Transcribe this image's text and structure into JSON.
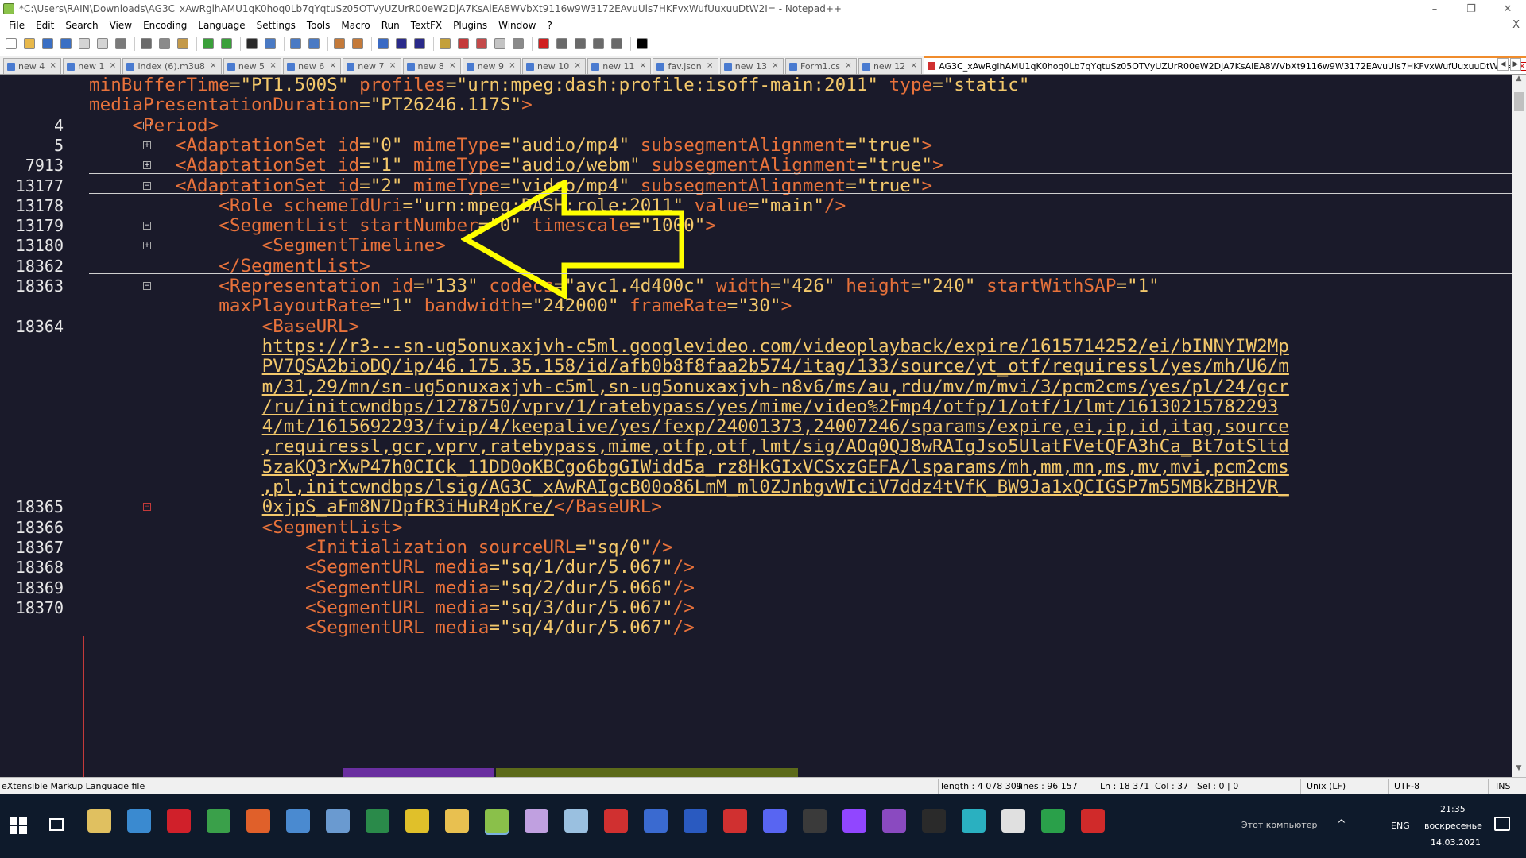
{
  "window": {
    "title": "*C:\\Users\\RAIN\\Downloads\\AG3C_xAwRglhAMU1qK0hoq0Lb7qYqtuSz05OTVyUZUrR00eW2DjA7KsAiEA8WVbXt9116w9W3172EAvuUls7HKFvxWufUuxuuDtW2I= - Notepad++",
    "controls": {
      "minimize": "–",
      "maximize": "❐",
      "close": "✕"
    }
  },
  "menu": [
    "File",
    "Edit",
    "Search",
    "View",
    "Encoding",
    "Language",
    "Settings",
    "Tools",
    "Macro",
    "Run",
    "TextFX",
    "Plugins",
    "Window",
    "?"
  ],
  "menu_close": "X",
  "toolbar_icons": [
    {
      "name": "new-file-icon",
      "color": "#ffffff"
    },
    {
      "name": "open-file-icon",
      "color": "#e8b84a"
    },
    {
      "name": "save-icon",
      "color": "#3a6fc4"
    },
    {
      "name": "save-all-icon",
      "color": "#3a6fc4"
    },
    {
      "name": "close-icon",
      "color": "#d4d4d4"
    },
    {
      "name": "close-all-icon",
      "color": "#d4d4d4"
    },
    {
      "name": "print-icon",
      "color": "#7a7a7a"
    },
    {
      "name": "cut-icon",
      "color": "#6a6a6a"
    },
    {
      "name": "copy-icon",
      "color": "#8a8a8a"
    },
    {
      "name": "paste-icon",
      "color": "#c49a4a"
    },
    {
      "name": "undo-icon",
      "color": "#3aa03a"
    },
    {
      "name": "redo-icon",
      "color": "#3aa03a"
    },
    {
      "name": "find-icon",
      "color": "#2a2a2a"
    },
    {
      "name": "replace-icon",
      "color": "#4a7ac4"
    },
    {
      "name": "zoom-in-icon",
      "color": "#4a7ac4"
    },
    {
      "name": "zoom-out-icon",
      "color": "#4a7ac4"
    },
    {
      "name": "sync-v-icon",
      "color": "#c47a3a"
    },
    {
      "name": "sync-h-icon",
      "color": "#c47a3a"
    },
    {
      "name": "word-wrap-icon",
      "color": "#3a6ac4"
    },
    {
      "name": "all-chars-icon",
      "color": "#2a2a8a"
    },
    {
      "name": "indent-guide-icon",
      "color": "#2a2a8a"
    },
    {
      "name": "udl-icon",
      "color": "#c4a03a"
    },
    {
      "name": "doc-map-icon",
      "color": "#c43a3a"
    },
    {
      "name": "func-list-icon",
      "color": "#c44a4a"
    },
    {
      "name": "folder-workspace-icon",
      "color": "#c4c4c4"
    },
    {
      "name": "monitor-icon",
      "color": "#8a8a8a"
    },
    {
      "name": "record-macro-icon",
      "color": "#d02020"
    },
    {
      "name": "stop-macro-icon",
      "color": "#6a6a6a"
    },
    {
      "name": "play-macro-icon",
      "color": "#6a6a6a"
    },
    {
      "name": "play-multi-icon",
      "color": "#6a6a6a"
    },
    {
      "name": "save-macro-icon",
      "color": "#6a6a6a"
    },
    {
      "name": "plugin-icon",
      "color": "#000000"
    }
  ],
  "tabs": [
    {
      "label": "new 4"
    },
    {
      "label": "new 1"
    },
    {
      "label": "index (6).m3u8"
    },
    {
      "label": "new 5"
    },
    {
      "label": "new 6"
    },
    {
      "label": "new 7"
    },
    {
      "label": "new 8"
    },
    {
      "label": "new 9"
    },
    {
      "label": "new 10"
    },
    {
      "label": "new 11"
    },
    {
      "label": "fav.json"
    },
    {
      "label": "new 13"
    },
    {
      "label": "Form1.cs"
    },
    {
      "label": "new 12"
    },
    {
      "label": "AG3C_xAwRglhAMU1qK0hoq0Lb7qYqtuSz05OTVyUZUrR00eW2DjA7KsAiEA8WVbXt9116w9W3172EAvuUls7HKFvxWufUuxuuDtW2I="
    }
  ],
  "tab_close": "×",
  "tab_scroll": {
    "left": "◀",
    "right": "▶"
  },
  "editor": {
    "line_numbers": [
      "",
      "",
      "4",
      "5",
      "7913",
      "13177",
      "13178",
      "13179",
      "13180",
      "18362",
      "18363",
      "",
      "18364",
      "",
      "",
      "",
      "",
      "",
      "",
      "",
      "",
      "18365",
      "18366",
      "18367",
      "18368",
      "18369",
      "18370"
    ],
    "fold_markers": [
      "",
      "",
      "−",
      "+",
      "+",
      "−",
      "",
      "−",
      "+",
      "",
      "−",
      "",
      "",
      "",
      "",
      "",
      "",
      "",
      "",
      "",
      "",
      "−",
      "",
      "",
      "",
      "",
      ""
    ],
    "lines": [
      {
        "indent": "",
        "parts": [
          {
            "c": "attr",
            "t": "minBufferTime"
          },
          {
            "c": "txt",
            "t": "="
          },
          {
            "c": "val",
            "t": "\"PT1.500S\""
          },
          {
            "c": "attr",
            "t": " profiles"
          },
          {
            "c": "txt",
            "t": "="
          },
          {
            "c": "val",
            "t": "\"urn:mpeg:dash:profile:isoff-main:2011\""
          },
          {
            "c": "attr",
            "t": " type"
          },
          {
            "c": "txt",
            "t": "="
          },
          {
            "c": "val",
            "t": "\"static\""
          }
        ]
      },
      {
        "indent": "",
        "parts": [
          {
            "c": "attr",
            "t": "mediaPresentationDuration"
          },
          {
            "c": "txt",
            "t": "="
          },
          {
            "c": "val",
            "t": "\"PT26246.117S\""
          },
          {
            "c": "tag",
            "t": ">"
          }
        ]
      },
      {
        "indent": "    ",
        "parts": [
          {
            "c": "tag",
            "t": "<Period>"
          }
        ]
      },
      {
        "indent": "        ",
        "parts": [
          {
            "c": "tag",
            "t": "<AdaptationSet"
          },
          {
            "c": "attr",
            "t": " id"
          },
          {
            "c": "txt",
            "t": "="
          },
          {
            "c": "val",
            "t": "\"0\""
          },
          {
            "c": "attr",
            "t": " mimeType"
          },
          {
            "c": "txt",
            "t": "="
          },
          {
            "c": "val",
            "t": "\"audio/mp4\""
          },
          {
            "c": "attr",
            "t": " subsegmentAlignment"
          },
          {
            "c": "txt",
            "t": "="
          },
          {
            "c": "val",
            "t": "\"true\""
          },
          {
            "c": "tag",
            "t": ">"
          }
        ]
      },
      {
        "indent": "        ",
        "parts": [
          {
            "c": "tag",
            "t": "<AdaptationSet"
          },
          {
            "c": "attr",
            "t": " id"
          },
          {
            "c": "txt",
            "t": "="
          },
          {
            "c": "val",
            "t": "\"1\""
          },
          {
            "c": "attr",
            "t": " mimeType"
          },
          {
            "c": "txt",
            "t": "="
          },
          {
            "c": "val",
            "t": "\"audio/webm\""
          },
          {
            "c": "attr",
            "t": " subsegmentAlignment"
          },
          {
            "c": "txt",
            "t": "="
          },
          {
            "c": "val",
            "t": "\"true\""
          },
          {
            "c": "tag",
            "t": ">"
          }
        ]
      },
      {
        "indent": "        ",
        "parts": [
          {
            "c": "tag",
            "t": "<AdaptationSet"
          },
          {
            "c": "attr",
            "t": " id"
          },
          {
            "c": "txt",
            "t": "="
          },
          {
            "c": "val",
            "t": "\"2\""
          },
          {
            "c": "attr",
            "t": " mimeType"
          },
          {
            "c": "txt",
            "t": "="
          },
          {
            "c": "val",
            "t": "\"video/mp4\""
          },
          {
            "c": "attr",
            "t": " subsegmentAlignment"
          },
          {
            "c": "txt",
            "t": "="
          },
          {
            "c": "val",
            "t": "\"true\""
          },
          {
            "c": "tag",
            "t": ">"
          }
        ]
      },
      {
        "indent": "            ",
        "parts": [
          {
            "c": "tag",
            "t": "<Role"
          },
          {
            "c": "attr",
            "t": " schemeIdUri"
          },
          {
            "c": "txt",
            "t": "="
          },
          {
            "c": "val",
            "t": "\"urn:mpeg:DASH:role:2011\""
          },
          {
            "c": "attr",
            "t": " value"
          },
          {
            "c": "txt",
            "t": "="
          },
          {
            "c": "val",
            "t": "\"main\""
          },
          {
            "c": "tag",
            "t": "/>"
          }
        ]
      },
      {
        "indent": "            ",
        "parts": [
          {
            "c": "tag",
            "t": "<SegmentList"
          },
          {
            "c": "attr",
            "t": " startNumber"
          },
          {
            "c": "txt",
            "t": "="
          },
          {
            "c": "val",
            "t": "\"0\""
          },
          {
            "c": "attr",
            "t": " timescale"
          },
          {
            "c": "txt",
            "t": "="
          },
          {
            "c": "val",
            "t": "\"1000\""
          },
          {
            "c": "tag",
            "t": ">"
          }
        ]
      },
      {
        "indent": "                ",
        "parts": [
          {
            "c": "tag",
            "t": "<SegmentTimeline>"
          }
        ]
      },
      {
        "indent": "            ",
        "parts": [
          {
            "c": "tag",
            "t": "</SegmentList>"
          }
        ]
      },
      {
        "indent": "            ",
        "parts": [
          {
            "c": "tag",
            "t": "<Representation"
          },
          {
            "c": "attr",
            "t": " id"
          },
          {
            "c": "txt",
            "t": "="
          },
          {
            "c": "val",
            "t": "\"133\""
          },
          {
            "c": "attr",
            "t": " codecs"
          },
          {
            "c": "txt",
            "t": "="
          },
          {
            "c": "val",
            "t": "\"avc1.4d400c\""
          },
          {
            "c": "attr",
            "t": " width"
          },
          {
            "c": "txt",
            "t": "="
          },
          {
            "c": "val",
            "t": "\"426\""
          },
          {
            "c": "attr",
            "t": " height"
          },
          {
            "c": "txt",
            "t": "="
          },
          {
            "c": "val",
            "t": "\"240\""
          },
          {
            "c": "attr",
            "t": " startWithSAP"
          },
          {
            "c": "txt",
            "t": "="
          },
          {
            "c": "val",
            "t": "\"1\""
          }
        ]
      },
      {
        "indent": "            ",
        "parts": [
          {
            "c": "attr",
            "t": "maxPlayoutRate"
          },
          {
            "c": "txt",
            "t": "="
          },
          {
            "c": "val",
            "t": "\"1\""
          },
          {
            "c": "attr",
            "t": " bandwidth"
          },
          {
            "c": "txt",
            "t": "="
          },
          {
            "c": "val",
            "t": "\"242000\""
          },
          {
            "c": "attr",
            "t": " frameRate"
          },
          {
            "c": "txt",
            "t": "="
          },
          {
            "c": "val",
            "t": "\"30\""
          },
          {
            "c": "tag",
            "t": ">"
          }
        ]
      },
      {
        "indent": "                ",
        "parts": [
          {
            "c": "tag",
            "t": "<BaseURL>"
          }
        ]
      },
      {
        "indent": "                ",
        "parts": [
          {
            "c": "url",
            "t": "https://r3---sn-ug5onuxaxjvh-c5ml.googlevideo.com/videoplayback/expire/1615714252/ei/bINNYIW2Mp"
          }
        ]
      },
      {
        "indent": "                ",
        "parts": [
          {
            "c": "url",
            "t": "PV7QSA2bioDQ/ip/46.175.35.158/id/afb0b8f8faa2b574/itag/133/source/yt_otf/requiressl/yes/mh/U6/m"
          }
        ]
      },
      {
        "indent": "                ",
        "parts": [
          {
            "c": "url",
            "t": "m/31,29/mn/sn-ug5onuxaxjvh-c5ml,sn-ug5onuxaxjvh-n8v6/ms/au,rdu/mv/m/mvi/3/pcm2cms/yes/pl/24/gcr"
          }
        ]
      },
      {
        "indent": "                ",
        "parts": [
          {
            "c": "url",
            "t": "/ru/initcwndbps/1278750/vprv/1/ratebypass/yes/mime/video%2Fmp4/otfp/1/otf/1/lmt/16130215782293"
          }
        ]
      },
      {
        "indent": "                ",
        "parts": [
          {
            "c": "url",
            "t": "4/mt/1615692293/fvip/4/keepalive/yes/fexp/24001373,24007246/sparams/expire,ei,ip,id,itag,source"
          }
        ]
      },
      {
        "indent": "                ",
        "parts": [
          {
            "c": "url",
            "t": ",requiressl,gcr,vprv,ratebypass,mime,otfp,otf,lmt/sig/AOq0QJ8wRAIgJso5UlatFVetQFA3hCa_Bt7otSltd"
          }
        ]
      },
      {
        "indent": "                ",
        "parts": [
          {
            "c": "url",
            "t": "5zaKQ3rXwP47h0CICk_11DD0oKBCgo6bgGIWidd5a_rz8HkGIxVCSxzGEFA/lsparams/mh,mm,mn,ms,mv,mvi,pcm2cms"
          }
        ]
      },
      {
        "indent": "                ",
        "parts": [
          {
            "c": "url",
            "t": ",pl,initcwndbps/lsig/AG3C_xAwRAIgcB00o86LmM_ml0ZJnbgvWIciV7ddz4tVfK_BW9Ja1xQCIGSP7m55MBkZBH2VR_"
          }
        ]
      },
      {
        "indent": "                ",
        "parts": [
          {
            "c": "url",
            "t": "0xjpS_aFm8N7DpfR3iHuR4pKre/"
          },
          {
            "c": "tag",
            "t": "</BaseURL>"
          }
        ]
      },
      {
        "indent": "                ",
        "parts": [
          {
            "c": "tag",
            "t": "<SegmentList>"
          }
        ]
      },
      {
        "indent": "                    ",
        "parts": [
          {
            "c": "tag",
            "t": "<Initialization"
          },
          {
            "c": "attr",
            "t": " sourceURL"
          },
          {
            "c": "txt",
            "t": "="
          },
          {
            "c": "val",
            "t": "\"sq/0\""
          },
          {
            "c": "tag",
            "t": "/>"
          }
        ]
      },
      {
        "indent": "                    ",
        "parts": [
          {
            "c": "tag",
            "t": "<SegmentURL"
          },
          {
            "c": "attr",
            "t": " media"
          },
          {
            "c": "txt",
            "t": "="
          },
          {
            "c": "val",
            "t": "\"sq/1/dur/5.067\""
          },
          {
            "c": "tag",
            "t": "/>"
          }
        ]
      },
      {
        "indent": "                    ",
        "parts": [
          {
            "c": "tag",
            "t": "<SegmentURL"
          },
          {
            "c": "attr",
            "t": " media"
          },
          {
            "c": "txt",
            "t": "="
          },
          {
            "c": "val",
            "t": "\"sq/2/dur/5.066\""
          },
          {
            "c": "tag",
            "t": "/>"
          }
        ]
      },
      {
        "indent": "                    ",
        "parts": [
          {
            "c": "tag",
            "t": "<SegmentURL"
          },
          {
            "c": "attr",
            "t": " media"
          },
          {
            "c": "txt",
            "t": "="
          },
          {
            "c": "val",
            "t": "\"sq/3/dur/5.067\""
          },
          {
            "c": "tag",
            "t": "/>"
          }
        ]
      },
      {
        "indent": "                    ",
        "parts": [
          {
            "c": "tag",
            "t": "<SegmentURL"
          },
          {
            "c": "attr",
            "t": " media"
          },
          {
            "c": "txt",
            "t": "="
          },
          {
            "c": "val",
            "t": "\"sq/4/dur/5.067\""
          },
          {
            "c": "tag",
            "t": "/>"
          }
        ]
      }
    ],
    "scroll": {
      "up": "▲",
      "down": "▼"
    }
  },
  "status": {
    "filetype": "eXtensible Markup Language file",
    "length": "length : 4 078 309",
    "lines": "lines : 96 157",
    "position": "Ln : 18 371",
    "col": "Col : 37",
    "sel": "Sel : 0 | 0",
    "eol": "Unix (LF)",
    "encoding": "UTF-8",
    "mode": "INS"
  },
  "taskbar": {
    "icons": [
      {
        "name": "calendar-app-icon",
        "color": "#e0c060"
      },
      {
        "name": "windows-app-icon",
        "color": "#3a8ad0"
      },
      {
        "name": "opera-icon",
        "color": "#d0202a"
      },
      {
        "name": "utorrent-icon",
        "color": "#3aa04a"
      },
      {
        "name": "firefox-icon",
        "color": "#e0602a"
      },
      {
        "name": "remote-desktop-icon",
        "color": "#4a8ad0"
      },
      {
        "name": "fax-icon",
        "color": "#6a9ad0"
      },
      {
        "name": "mediainfo-icon",
        "color": "#2a8a4a"
      },
      {
        "name": "chrome-icon",
        "color": "#e0c02a"
      },
      {
        "name": "explorer-icon",
        "color": "#e8c050"
      },
      {
        "name": "notepadpp-icon",
        "color": "#8ac04a"
      },
      {
        "name": "butterfly-app-icon",
        "color": "#c0a0e0"
      },
      {
        "name": "cube-app-icon",
        "color": "#9ac0e0"
      },
      {
        "name": "zip-app-icon",
        "color": "#d03030"
      },
      {
        "name": "network-app-icon",
        "color": "#3a6ad0"
      },
      {
        "name": "lightshot-icon",
        "color": "#2a5ac0"
      },
      {
        "name": "dx-app-icon",
        "color": "#d03030"
      },
      {
        "name": "discord-icon",
        "color": "#5865f2"
      },
      {
        "name": "obs-icon",
        "color": "#3a3a3a"
      },
      {
        "name": "twitch-icon",
        "color": "#9146ff"
      },
      {
        "name": "visual-studio-icon",
        "color": "#8a4ac0"
      },
      {
        "name": "terminal-icon",
        "color": "#2a2a2a"
      },
      {
        "name": "vpn-icon",
        "color": "#2ab0c0"
      },
      {
        "name": "window-app-icon",
        "color": "#e0e0e0"
      },
      {
        "name": "pycharm-icon",
        "color": "#2aa04a"
      },
      {
        "name": "rx-app-icon",
        "color": "#d02a2a"
      }
    ],
    "computer_label": "Этот компьютер",
    "tray_up": "^",
    "lang": "ENG",
    "time": "21:35",
    "day": "воскресенье",
    "date": "14.03.2021"
  }
}
